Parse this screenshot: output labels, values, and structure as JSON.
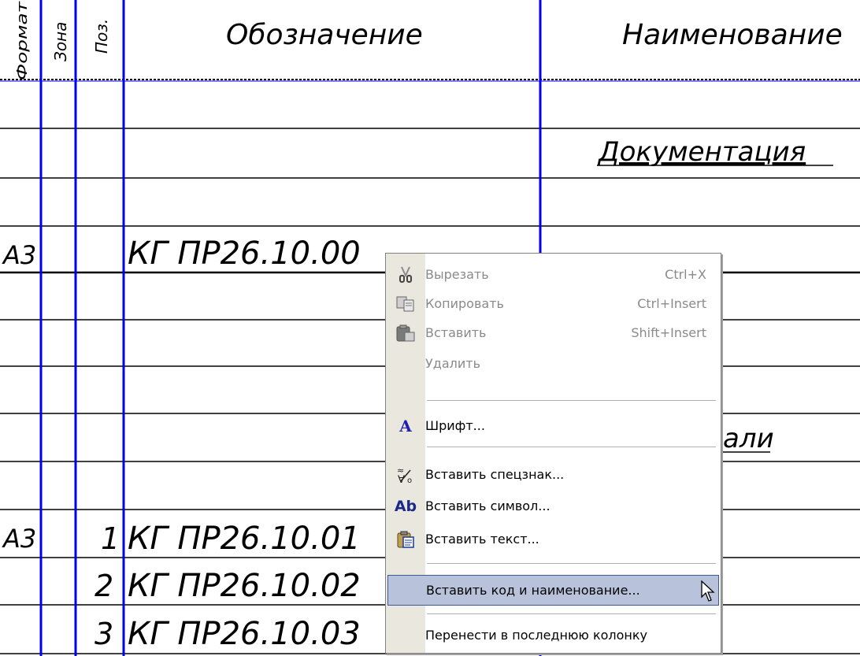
{
  "spec_table": {
    "headers": {
      "format": "Формат",
      "zone": "Зона",
      "position": "Поз.",
      "designation": "Обозначение",
      "name": "Наименование"
    },
    "section_documentation": "Документация",
    "section_details_fragment": "али",
    "rows": [
      {
        "format": "А3",
        "position": "",
        "designation": "КГ ПР26.10.00"
      },
      {
        "format": "А3",
        "position": "1",
        "designation": "КГ ПР26.10.01"
      },
      {
        "format": "",
        "position": "2",
        "designation": "КГ ПР26.10.02"
      },
      {
        "format": "",
        "position": "3",
        "designation": "КГ ПР26.10.03"
      }
    ],
    "colors": {
      "grid_blue": "#0000ee",
      "text": "#000000"
    }
  },
  "context_menu": {
    "items": [
      {
        "label": "Вырезать",
        "shortcut": "Ctrl+X",
        "icon": "scissors-icon",
        "disabled": true
      },
      {
        "label": "Копировать",
        "shortcut": "Ctrl+Insert",
        "icon": "copy-icon",
        "disabled": true
      },
      {
        "label": "Вставить",
        "shortcut": "Shift+Insert",
        "icon": "paste-icon",
        "disabled": true
      },
      {
        "label": "Удалить",
        "shortcut": "",
        "icon": "",
        "disabled": true
      },
      {
        "label": "Шрифт...",
        "shortcut": "",
        "icon": "font-icon",
        "disabled": false
      },
      {
        "label": "Вставить спецзнак...",
        "shortcut": "",
        "icon": "special-sign-icon",
        "disabled": false
      },
      {
        "label": "Вставить символ...",
        "shortcut": "",
        "icon": "symbol-icon",
        "disabled": false
      },
      {
        "label": "Вставить текст...",
        "shortcut": "",
        "icon": "insert-text-icon",
        "disabled": false
      },
      {
        "label": "Вставить код и наименование...",
        "shortcut": "",
        "icon": "",
        "disabled": false,
        "highlighted": true
      },
      {
        "label": "Перенести в последнюю колонку",
        "shortcut": "",
        "icon": "",
        "disabled": false
      }
    ],
    "colors": {
      "gutter": "#eae7df",
      "highlight": "#b8c3db",
      "highlight_border": "#3e5796",
      "disabled_text": "#8a8a8a"
    }
  }
}
